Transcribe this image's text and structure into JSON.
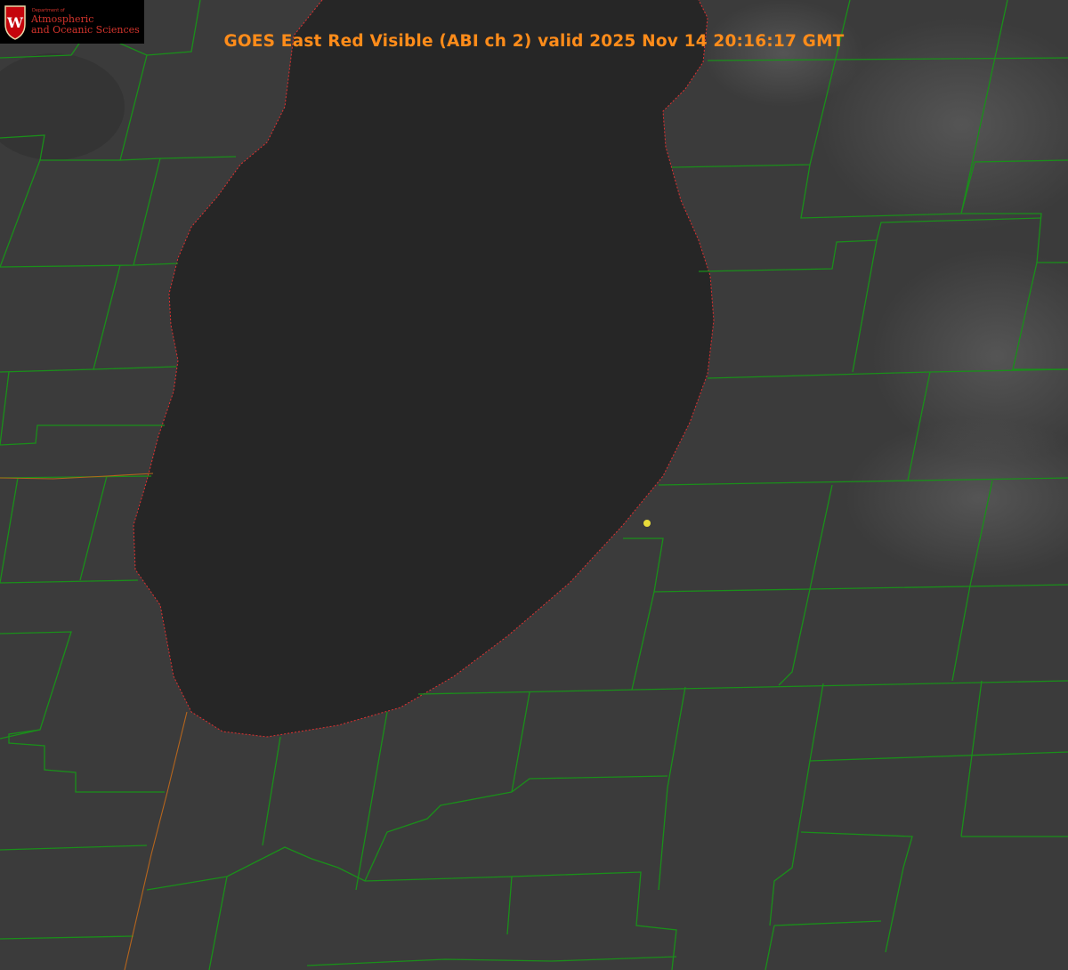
{
  "title": "GOES East Red Visible (ABI ch 2) valid 2025 Nov 14 20:16:17 GMT",
  "logo": {
    "department": "Department of",
    "line1": "Atmospheric",
    "line2": "and Oceanic Sciences",
    "shield_letter": "W"
  },
  "colors": {
    "title": "#ff8c1a",
    "county_lines": "#1a8f1a",
    "state_line": "#b5651d",
    "shoreline": "#e03030",
    "marker": "#e8dc3a",
    "lake": "#262626",
    "land": "#3b3b3b"
  }
}
